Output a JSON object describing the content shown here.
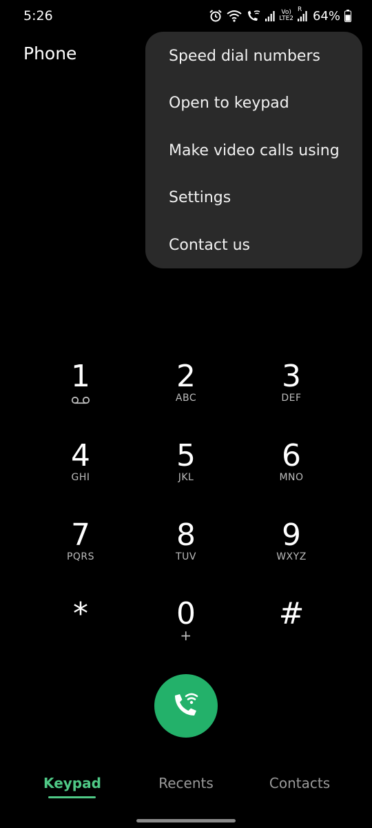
{
  "status_bar": {
    "time": "5:26",
    "battery": "64%",
    "network_label": "LTE2",
    "volte_label": "Vo)",
    "roaming_label": "R",
    "icons": [
      "alarm-icon",
      "wifi-calling-icon",
      "wifi-call-icon",
      "signal-icon",
      "volte-icon",
      "signal-icon",
      "battery-icon"
    ]
  },
  "header": {
    "title": "Phone"
  },
  "menu": {
    "items": [
      {
        "label": "Speed dial numbers"
      },
      {
        "label": "Open to keypad"
      },
      {
        "label": "Make video calls using"
      },
      {
        "label": "Settings"
      },
      {
        "label": "Contact us"
      }
    ]
  },
  "keypad": {
    "keys": [
      {
        "digit": "1",
        "letters": "",
        "sub_icon": "voicemail-icon"
      },
      {
        "digit": "2",
        "letters": "ABC"
      },
      {
        "digit": "3",
        "letters": "DEF"
      },
      {
        "digit": "4",
        "letters": "GHI"
      },
      {
        "digit": "5",
        "letters": "JKL"
      },
      {
        "digit": "6",
        "letters": "MNO"
      },
      {
        "digit": "7",
        "letters": "PQRS"
      },
      {
        "digit": "8",
        "letters": "TUV"
      },
      {
        "digit": "9",
        "letters": "WXYZ"
      },
      {
        "digit": "*",
        "letters": ""
      },
      {
        "digit": "0",
        "letters": "+"
      },
      {
        "digit": "#",
        "letters": ""
      }
    ]
  },
  "call_button": {
    "icon": "wifi-call-icon",
    "color": "#23b16a"
  },
  "tabs": [
    {
      "label": "Keypad",
      "active": true
    },
    {
      "label": "Recents",
      "active": false
    },
    {
      "label": "Contacts",
      "active": false
    }
  ],
  "colors": {
    "accent": "#4fc986",
    "background": "#000000",
    "menu_background": "#2a2a2a"
  }
}
